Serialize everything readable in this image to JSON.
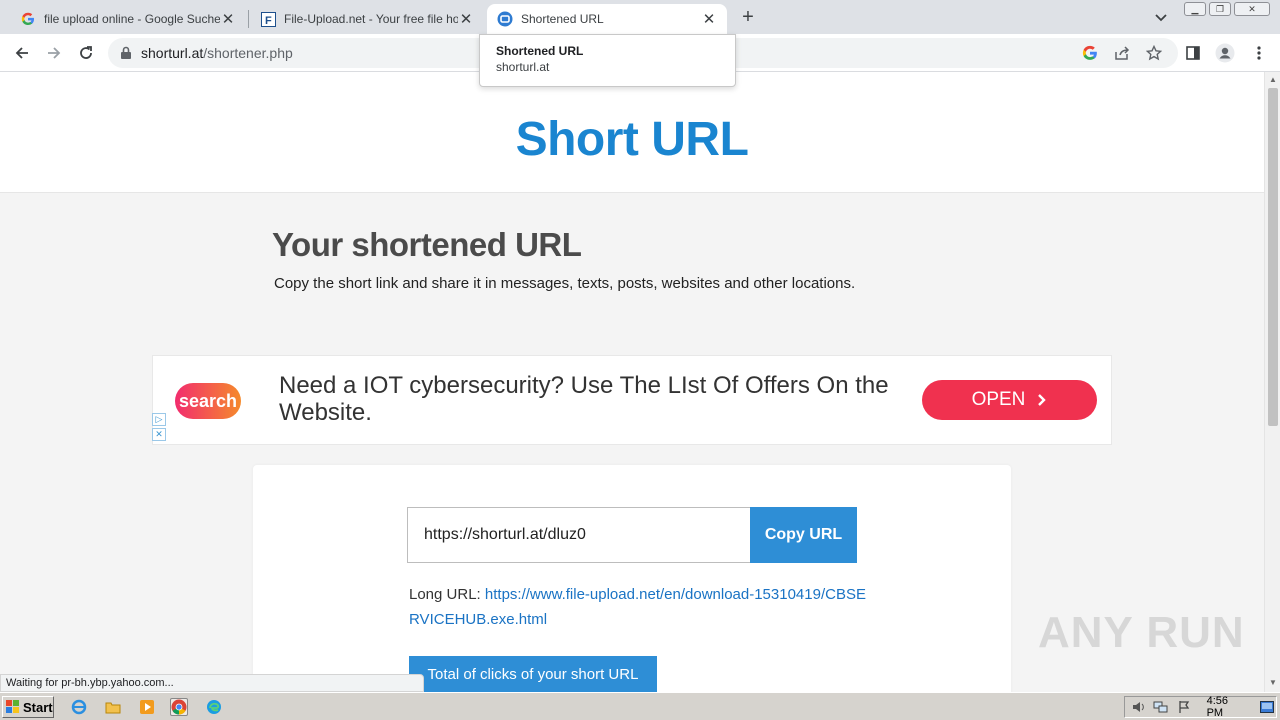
{
  "browser": {
    "tabs": [
      {
        "title": "file upload online - Google Suche",
        "favicon": "google-g-icon",
        "active": false
      },
      {
        "title": "File-Upload.net - Your free file hoste",
        "favicon": "file-upload-f-icon",
        "active": false
      },
      {
        "title": "Shortened URL",
        "favicon": "shorturl-icon",
        "active": true
      }
    ],
    "new_tab": "+",
    "address": {
      "host": "shorturl.at",
      "path": "/shortener.php"
    },
    "hover_card": {
      "title": "Shortened URL",
      "host": "shorturl.at"
    },
    "status_text": "Waiting for pr-bh.ybp.yahoo.com..."
  },
  "page": {
    "logo": "Short URL",
    "heading": "Your shortened URL",
    "subtext": "Copy the short link and share it in messages, texts, posts, websites and other locations.",
    "ad": {
      "logo_text": "search",
      "text": "Need a IOT cybersecurity? Use The LIst Of Offers On the Website.",
      "button": "OPEN"
    },
    "short_url": "https://shorturl.at/dluz0",
    "copy_button": "Copy URL",
    "long_url_label": "Long URL:",
    "long_url": "https://www.file-upload.net/en/download-15310419/CBSERVICEHUB.exe.html",
    "clicks_button": "Total of clicks of your short URL"
  },
  "watermark": "ANY RUN",
  "taskbar": {
    "start": "Start",
    "clock": "4:56 PM"
  },
  "colors": {
    "accent": "#2e8ed6",
    "logo": "#1a85d0",
    "ad_button": "#f0314f"
  }
}
